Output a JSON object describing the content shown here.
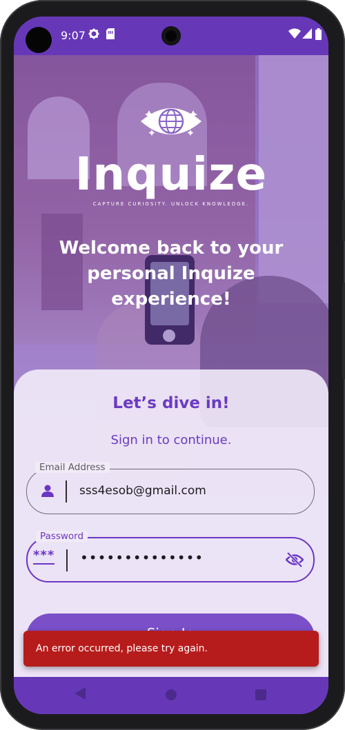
{
  "status_bar": {
    "time": "9:07"
  },
  "brand": {
    "name": "Inquize",
    "tagline": "CAPTURE CURIOSITY. UNLOCK KNOWLEDGE."
  },
  "welcome": {
    "line1": "Welcome back to your",
    "line2": "personal Inquize",
    "line3": "experience!"
  },
  "login": {
    "title": "Let’s dive in!",
    "subtitle": "Sign in to continue.",
    "email": {
      "label": "Email Address",
      "value": "sss4esob@gmail.com"
    },
    "password": {
      "label": "Password",
      "value": "••••••••••••••",
      "icon_text": "***"
    },
    "signin_label": "Sign In"
  },
  "snackbar": {
    "message": "An error occurred, please try again."
  },
  "colors": {
    "primary": "#6638b8",
    "accent_text": "#6a3bc2",
    "error": "#b71c1c"
  }
}
